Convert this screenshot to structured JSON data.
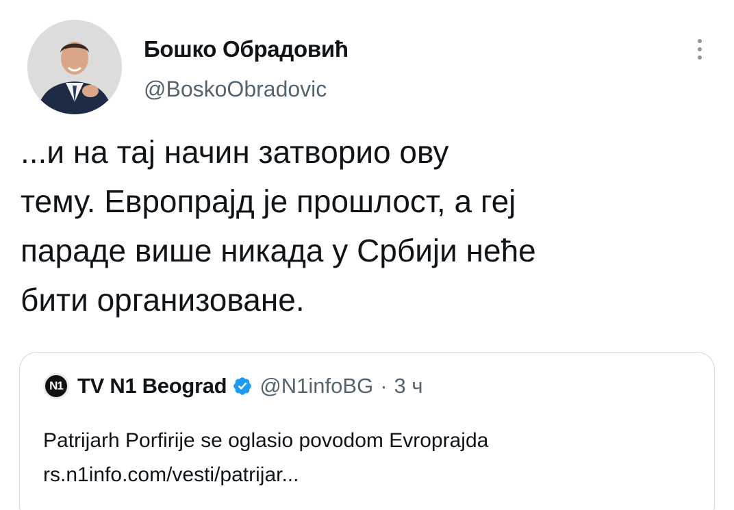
{
  "author": {
    "display_name": "Бошко Обрадовић",
    "handle": "@BoskoObradovic",
    "avatar_icon": "profile-photo"
  },
  "more_icon": "more-vertical-icon",
  "tweet": {
    "text": "...и на тај начин затворио ову\nтему. Европрајд је прошлост, а геј\nпараде више никада у Србији неће\nбити организоване."
  },
  "quote": {
    "logo_text": "N1",
    "name": "TV N1 Beograd",
    "verified_icon": "verified-badge-icon",
    "verified_color": "#1d9bf0",
    "handle": "@N1infoBG",
    "separator": "·",
    "time": "3 ч",
    "text": "Patrijarh Porfirije se oglasio povodom Evroprajda",
    "link": "rs.n1info.com/vesti/patrijar..."
  }
}
